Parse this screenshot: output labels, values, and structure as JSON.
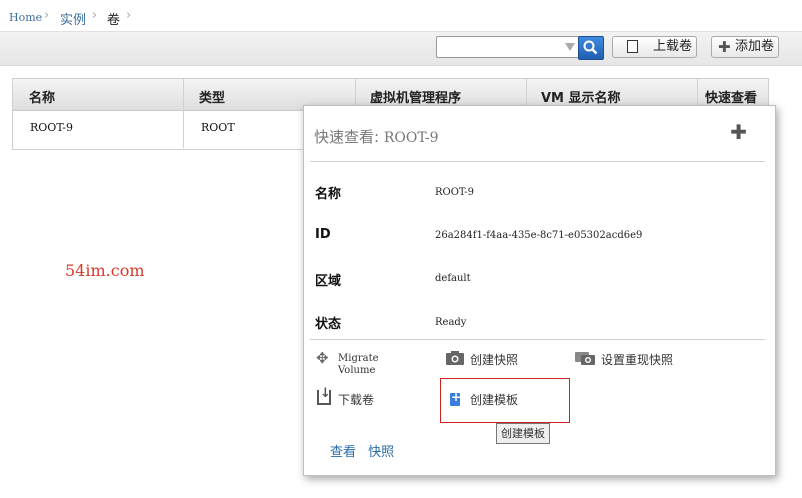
{
  "breadcrumb": {
    "home": "Home",
    "instances": "实例",
    "current": "卷"
  },
  "toolbar": {
    "search_value": "",
    "upload_label": "上载卷",
    "add_label": "添加卷"
  },
  "table": {
    "headers": [
      "名称",
      "类型",
      "虚拟机管理程序",
      "VM 显示名称",
      "快速查看"
    ],
    "rows": [
      {
        "name": "ROOT-9",
        "type": "ROOT"
      }
    ]
  },
  "quickview": {
    "title_prefix": "快速查看:",
    "title_value": "ROOT-9",
    "details": [
      {
        "label": "名称",
        "value": "ROOT-9"
      },
      {
        "label": "ID",
        "value": "26a284f1-f4aa-435e-8c71-e05302acd6e9"
      },
      {
        "label": "区域",
        "value": "default"
      },
      {
        "label": "状态",
        "value": "Ready"
      }
    ],
    "actions": {
      "migrate_line1": "Migrate",
      "migrate_line2": "Volume",
      "snapshot": "创建快照",
      "recurring_snapshot": "设置重现快照",
      "download": "下载卷",
      "create_template": "创建模板"
    },
    "tooltip": "创建模板",
    "links": [
      "查看",
      "快照"
    ]
  },
  "watermark": "54im.com",
  "colors": {
    "link": "#2a6ca8",
    "highlight": "#cc2222",
    "search_button": "#2f74c8"
  }
}
